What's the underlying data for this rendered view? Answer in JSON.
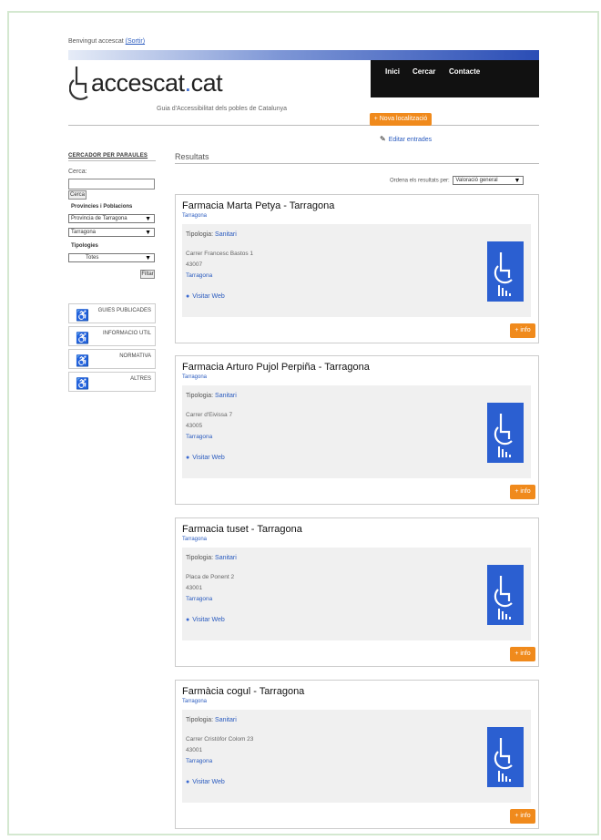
{
  "header": {
    "welcome": "Benvingut accescat",
    "sortir": "(Sortir)",
    "logo_text": "accescat",
    "logo_suffix": "cat",
    "tagline": "Guia d'Accessibilitat dels pobles de Catalunya",
    "nav": [
      "Inici",
      "Cercar",
      "Contacte"
    ],
    "nova_button": "+ Nova localització",
    "editar": "Editar entrades"
  },
  "sidebar": {
    "title": "CERCADOR PER PARAULES",
    "cerca_label": "Cerca:",
    "cerca_value": "",
    "cerca_button": "Cerca",
    "provincies_title": "Provincies i Poblacions",
    "provincia_select": "Provincia de Tarragona",
    "poblacio_select": "Tarragona",
    "tipologies_title": "Tipologies",
    "tipologia_select": "Totes",
    "filtrar_button": "Filtar",
    "menu": [
      "GUIES PUBLICADES",
      "INFORMACIO UTIL",
      "NORMATIVA",
      "ALTRES"
    ]
  },
  "results": {
    "title": "Resultats",
    "ordena_label": "Ordena els resultats per:",
    "ordena_select": "Valoració general",
    "tipologia_label": "Tipologia:",
    "visit_label": "Visitar Web",
    "info_label": "+ info",
    "items": [
      {
        "name": "Farmacia Marta Petya - Tarragona",
        "city": "Tarragona",
        "tipologia": "Sanitari",
        "street": "Carrer Francesc Bastos 1",
        "zip": "43007",
        "town": "Tarragona"
      },
      {
        "name": "Farmacia Arturo Pujol Perpiña - Tarragona",
        "city": "Tarragona",
        "tipologia": "Sanitari",
        "street": "Carrer d'Eivissa 7",
        "zip": "43005",
        "town": "Tarragona"
      },
      {
        "name": "Farmacia tuset - Tarragona",
        "city": "Tarragona",
        "tipologia": "Sanitari",
        "street": "Placa de Ponent 2",
        "zip": "43001",
        "town": "Tarragona"
      },
      {
        "name": "Farmàcia cogul - Tarragona",
        "city": "Tarragona",
        "tipologia": "Sanitari",
        "street": "Carrer Cristòfor Colom 23",
        "zip": "43001",
        "town": "Tarragona"
      }
    ]
  },
  "colors": {
    "accent_orange": "#f08a1c",
    "badge_blue": "#2b5fd1",
    "link_blue": "#2a5bbf",
    "nav_black": "#111111"
  }
}
